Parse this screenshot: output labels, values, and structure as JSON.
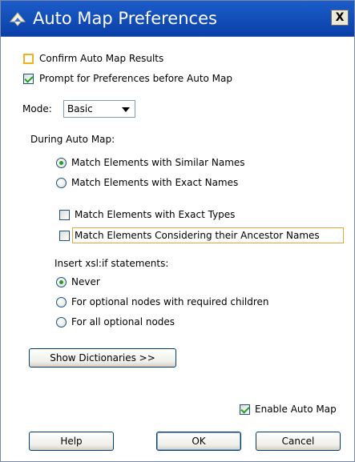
{
  "window": {
    "title": "Auto Map Preferences",
    "close_label": "X",
    "icon": "lightning-arrow-icon"
  },
  "options": {
    "confirm_results": {
      "label": "Confirm Auto Map Results",
      "checked": false
    },
    "prompt_prefs": {
      "label": "Prompt for Preferences before Auto Map",
      "checked": true
    }
  },
  "mode": {
    "label": "Mode:",
    "value": "Basic"
  },
  "during": {
    "heading": "During Auto Map:",
    "similar_names": {
      "label": "Match Elements with Similar Names",
      "selected": true
    },
    "exact_names": {
      "label": "Match Elements with Exact Names",
      "selected": false
    },
    "exact_types": {
      "label": "Match Elements with Exact Types",
      "checked": false
    },
    "ancestor_names": {
      "label": "Match Elements Considering their Ancestor Names",
      "checked": false
    }
  },
  "xsl": {
    "heading": "Insert xsl:if statements:",
    "never": {
      "label": "Never",
      "selected": true
    },
    "optional_required": {
      "label": "For optional nodes with required children",
      "selected": false
    },
    "all_optional": {
      "label": "For all optional nodes",
      "selected": false
    }
  },
  "buttons": {
    "show_dictionaries": "Show Dictionaries >>",
    "help": "Help",
    "ok": "OK",
    "cancel": "Cancel"
  },
  "enable_auto_map": {
    "label": "Enable Auto Map",
    "checked": true
  },
  "colors": {
    "titlebar": "#0a3fa8",
    "focus": "#e8a33a",
    "check": "#21a121"
  }
}
